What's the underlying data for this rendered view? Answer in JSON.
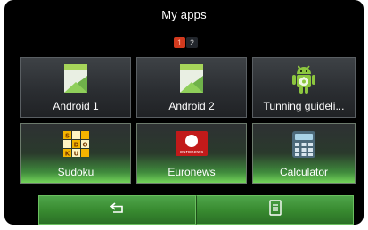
{
  "header": {
    "title": "My apps"
  },
  "pager": {
    "pages": [
      "1",
      "2"
    ],
    "current": "1"
  },
  "apps": [
    {
      "label": "Android 1",
      "icon": "android-app-icon"
    },
    {
      "label": "Android 2",
      "icon": "android-app-icon"
    },
    {
      "label": "Tunning guideli...",
      "icon": "android-robot-icon"
    },
    {
      "label": "Sudoku",
      "icon": "sudoku-icon"
    },
    {
      "label": "Euronews",
      "icon": "euronews-icon",
      "icon_text": "euronews"
    },
    {
      "label": "Calculator",
      "icon": "calculator-icon"
    }
  ],
  "bottom_bar": {
    "back_icon": "back-arrow-icon",
    "menu_icon": "menu-icon"
  },
  "colors": {
    "accent": "#3d9a38",
    "page_active": "#d23a1e",
    "background": "#000000"
  }
}
